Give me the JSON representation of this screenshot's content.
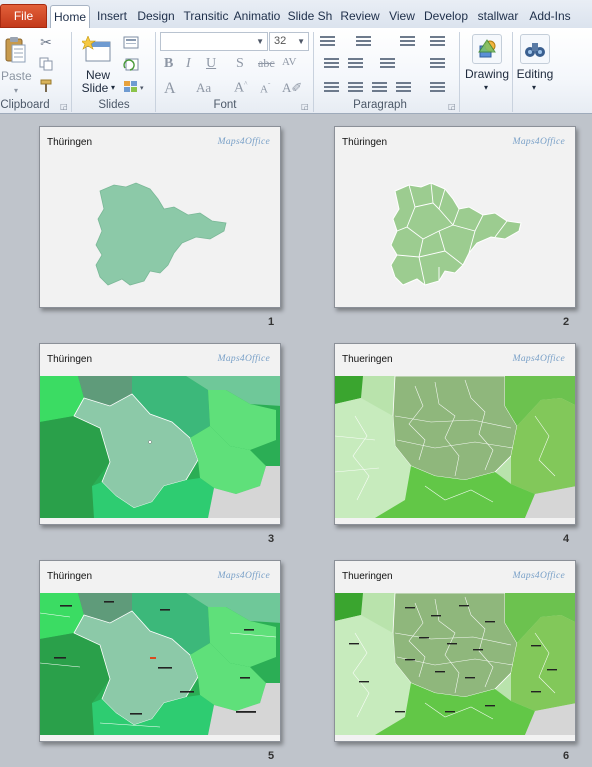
{
  "tabs": {
    "file": "File",
    "home": "Home",
    "insert": "Insert",
    "design": "Design",
    "transitions": "Transitic",
    "animations": "Animatio",
    "slideshow": "Slide Sh",
    "review": "Review",
    "view": "View",
    "developer": "Develop",
    "stallwar": "stallwar",
    "addins": "Add-Ins"
  },
  "ribbon": {
    "clipboard": {
      "label": "Clipboard",
      "paste_label": "Paste"
    },
    "slides": {
      "label": "Slides",
      "new_slide_line1": "New",
      "new_slide_line2": "Slide"
    },
    "font": {
      "label": "Font",
      "size_value": "32"
    },
    "paragraph": {
      "label": "Paragraph"
    },
    "drawing": {
      "label": "Drawing"
    },
    "editing": {
      "label": "Editing"
    }
  },
  "slides": [
    {
      "num": "1",
      "title": "Thüringen",
      "logo": "Maps4Office"
    },
    {
      "num": "2",
      "title": "Thüringen",
      "logo": "Maps4Office"
    },
    {
      "num": "3",
      "title": "Thüringen",
      "logo": "Maps4Office"
    },
    {
      "num": "4",
      "title": "Thueringen",
      "logo": "Maps4Office"
    },
    {
      "num": "5",
      "title": "Thüringen",
      "logo": "Maps4Office"
    },
    {
      "num": "6",
      "title": "Thueringen",
      "logo": "Maps4Office"
    }
  ],
  "colors": {
    "map_teal": "#8cc9a8",
    "map_green": "#9ccc90",
    "neighbor_green": "#2ecc71",
    "accent_orange": "#d94a1e"
  }
}
